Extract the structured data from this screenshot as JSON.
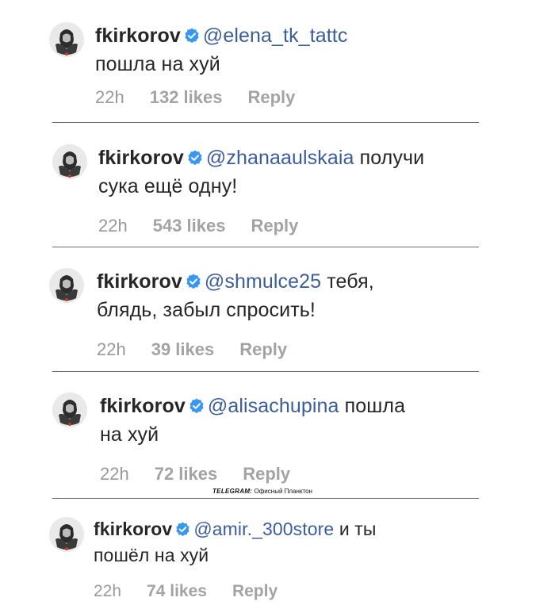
{
  "comments": [
    {
      "username": "fkirkorov",
      "mention": "@elena_tk_tattc",
      "text_same_line": "",
      "text_continued": "пошла на хуй",
      "time": "22h",
      "likes": "132 likes",
      "reply": "Reply"
    },
    {
      "username": "fkirkorov",
      "mention": "@zhanaaulskaia",
      "text_same_line": "получи",
      "text_continued": "сука ещё одну!",
      "time": "22h",
      "likes": "543 likes",
      "reply": "Reply"
    },
    {
      "username": "fkirkorov",
      "mention": "@shmulce25",
      "text_same_line": "тебя,",
      "text_continued": "блядь, забыл спросить!",
      "time": "22h",
      "likes": "39 likes",
      "reply": "Reply"
    },
    {
      "username": "fkirkorov",
      "mention": "@alisachupina",
      "text_same_line": "пошла",
      "text_continued": "на хуй",
      "time": "22h",
      "likes": "72 likes",
      "reply": "Reply"
    },
    {
      "username": "fkirkorov",
      "mention": "@amir._300store",
      "text_same_line": "и ты",
      "text_continued": "пошёл на хуй",
      "time": "22h",
      "likes": "74 likes",
      "reply": "Reply"
    }
  ],
  "watermark": {
    "brand": "TELEGRAM:",
    "channel": "Офисный Планктон"
  },
  "colors": {
    "text": "#262626",
    "mention": "#3b5d9c",
    "meta": "#999999",
    "verified": "#3897f0"
  },
  "icons": {
    "verified": "verified-badge-icon",
    "avatar": "avatar-portrait"
  }
}
